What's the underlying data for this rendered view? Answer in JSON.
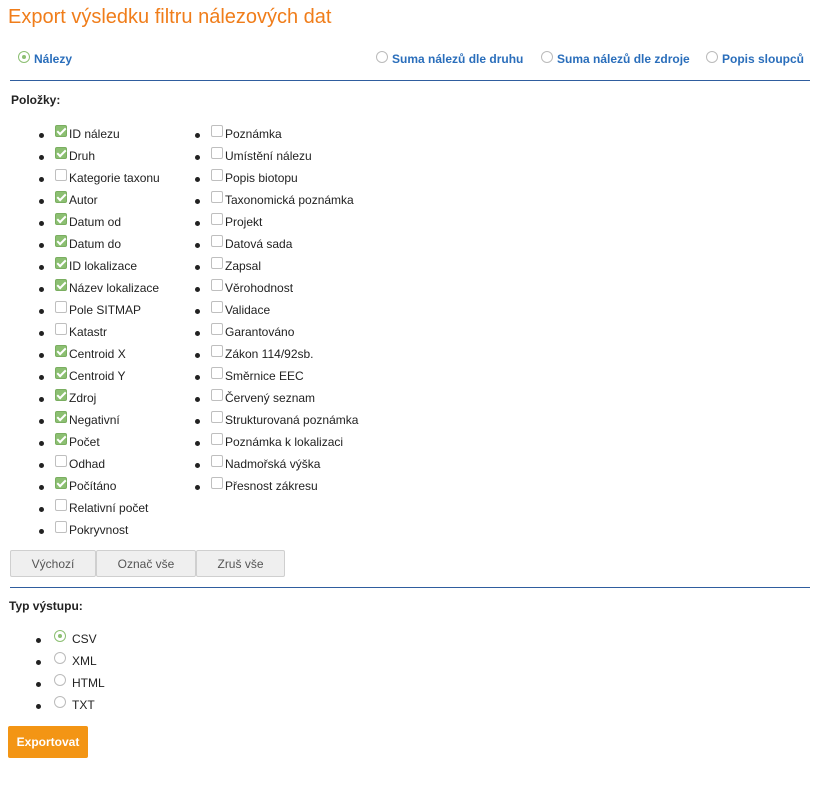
{
  "title": "Export výsledku filtru nálezových dat",
  "tabs": [
    {
      "label": "Nálezy",
      "selected": true
    },
    {
      "label": "Suma nálezů dle druhu",
      "selected": false
    },
    {
      "label": "Suma nálezů dle zdroje",
      "selected": false
    },
    {
      "label": "Popis sloupců",
      "selected": false
    }
  ],
  "items_label": "Položky:",
  "items_left": [
    {
      "label": "ID nálezu",
      "checked": true
    },
    {
      "label": "Druh",
      "checked": true
    },
    {
      "label": "Kategorie taxonu",
      "checked": false
    },
    {
      "label": "Autor",
      "checked": true
    },
    {
      "label": "Datum od",
      "checked": true
    },
    {
      "label": "Datum do",
      "checked": true
    },
    {
      "label": "ID lokalizace",
      "checked": true
    },
    {
      "label": "Název lokalizace",
      "checked": true
    },
    {
      "label": "Pole SITMAP",
      "checked": false
    },
    {
      "label": "Katastr",
      "checked": false
    },
    {
      "label": "Centroid X",
      "checked": true
    },
    {
      "label": "Centroid Y",
      "checked": true
    },
    {
      "label": "Zdroj",
      "checked": true
    },
    {
      "label": "Negativní",
      "checked": true
    },
    {
      "label": "Počet",
      "checked": true
    },
    {
      "label": "Odhad",
      "checked": false
    },
    {
      "label": "Počítáno",
      "checked": true
    },
    {
      "label": "Relativní počet",
      "checked": false
    },
    {
      "label": "Pokryvnost",
      "checked": false
    }
  ],
  "items_right": [
    {
      "label": "Poznámka",
      "checked": false
    },
    {
      "label": "Umístění nálezu",
      "checked": false
    },
    {
      "label": "Popis biotopu",
      "checked": false
    },
    {
      "label": "Taxonomická poznámka",
      "checked": false
    },
    {
      "label": "Projekt",
      "checked": false
    },
    {
      "label": "Datová sada",
      "checked": false
    },
    {
      "label": "Zapsal",
      "checked": false
    },
    {
      "label": "Věrohodnost",
      "checked": false
    },
    {
      "label": "Validace",
      "checked": false
    },
    {
      "label": "Garantováno",
      "checked": false
    },
    {
      "label": "Zákon 114/92sb.",
      "checked": false
    },
    {
      "label": "Směrnice EEC",
      "checked": false
    },
    {
      "label": "Červený seznam",
      "checked": false
    },
    {
      "label": "Strukturovaná poznámka",
      "checked": false
    },
    {
      "label": "Poznámka k lokalizaci",
      "checked": false
    },
    {
      "label": "Nadmořská výška",
      "checked": false
    },
    {
      "label": "Přesnost zákresu",
      "checked": false
    }
  ],
  "buttons": {
    "default_label": "Výchozí",
    "select_all_label": "Označ vše",
    "clear_all_label": "Zruš vše"
  },
  "output_label": "Typ výstupu:",
  "output_types": [
    {
      "label": "CSV",
      "selected": true
    },
    {
      "label": "XML",
      "selected": false
    },
    {
      "label": "HTML",
      "selected": false
    },
    {
      "label": "TXT",
      "selected": false
    }
  ],
  "export_label": "Exportovat",
  "colors": {
    "accent": "#f07d1a",
    "link": "#2a6ebb",
    "check": "#8cbf72",
    "export_button": "#f39514"
  }
}
